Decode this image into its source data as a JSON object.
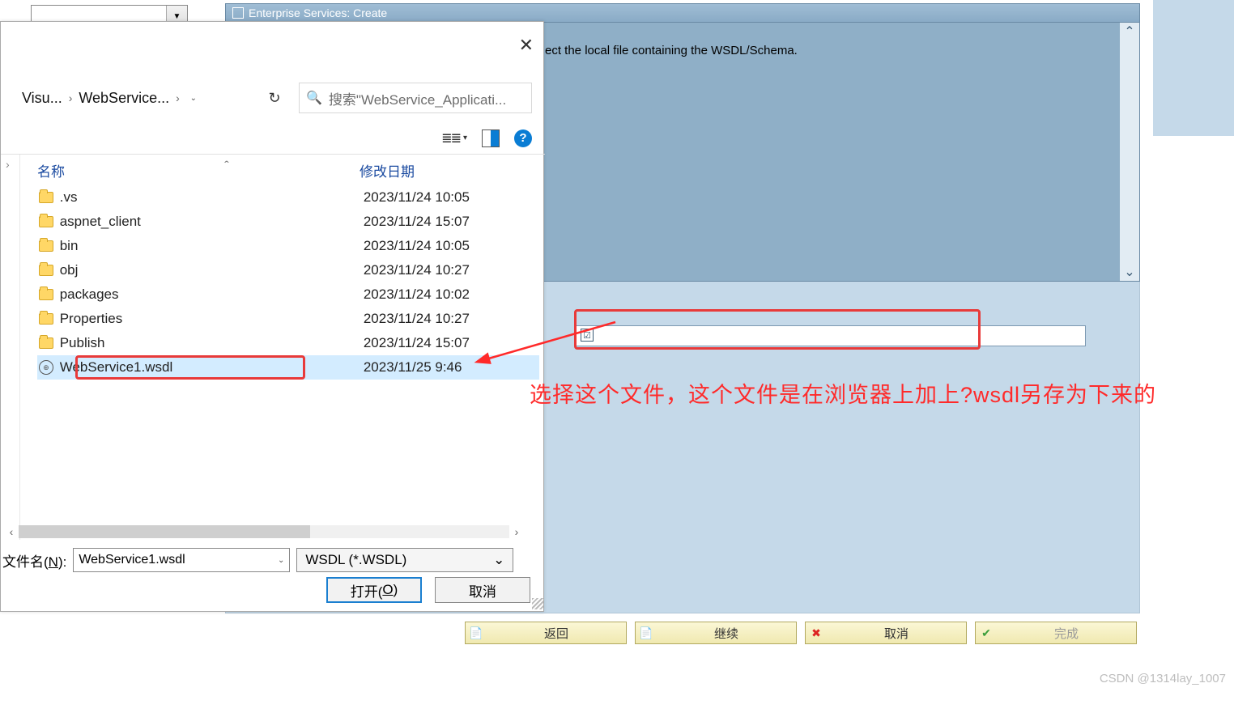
{
  "bg": {
    "title": "Enterprise Services: Create",
    "body_text": "ect the local file containing the WSDL/Schema."
  },
  "truncated_dropdown": "",
  "dialog": {
    "breadcrumb": {
      "part1": "Visu...",
      "part2": "WebService...",
      "sep": "›"
    },
    "search_placeholder": "搜索\"WebService_Applicati...",
    "columns": {
      "name": "名称",
      "date": "修改日期"
    },
    "rows": [
      {
        "type": "folder",
        "name": ".vs",
        "date": "2023/11/24 10:05"
      },
      {
        "type": "folder",
        "name": "aspnet_client",
        "date": "2023/11/24 15:07"
      },
      {
        "type": "folder",
        "name": "bin",
        "date": "2023/11/24 10:05"
      },
      {
        "type": "folder",
        "name": "obj",
        "date": "2023/11/24 10:27"
      },
      {
        "type": "folder",
        "name": "packages",
        "date": "2023/11/24 10:02"
      },
      {
        "type": "folder",
        "name": "Properties",
        "date": "2023/11/24 10:27"
      },
      {
        "type": "folder",
        "name": "Publish",
        "date": "2023/11/24 15:07"
      },
      {
        "type": "wsdl",
        "name": "WebService1.wsdl",
        "date": "2023/11/25 9:46",
        "selected": true
      }
    ],
    "filename_label_pre": "文件名(",
    "filename_label_u": "N",
    "filename_label_post": "):",
    "filename_value": "WebService1.wsdl",
    "filetype_value": "WSDL (*.WSDL)",
    "open_btn_pre": "打开(",
    "open_btn_u": "O",
    "open_btn_post": ")",
    "cancel_btn": "取消"
  },
  "annotation": "选择这个文件，这个文件是在浏览器上加上?wsdl另存为下来的",
  "sap_buttons": {
    "back": "返回",
    "next": "继续",
    "cancel": "取消",
    "done": "完成"
  },
  "watermark": "CSDN @1314lay_1007"
}
